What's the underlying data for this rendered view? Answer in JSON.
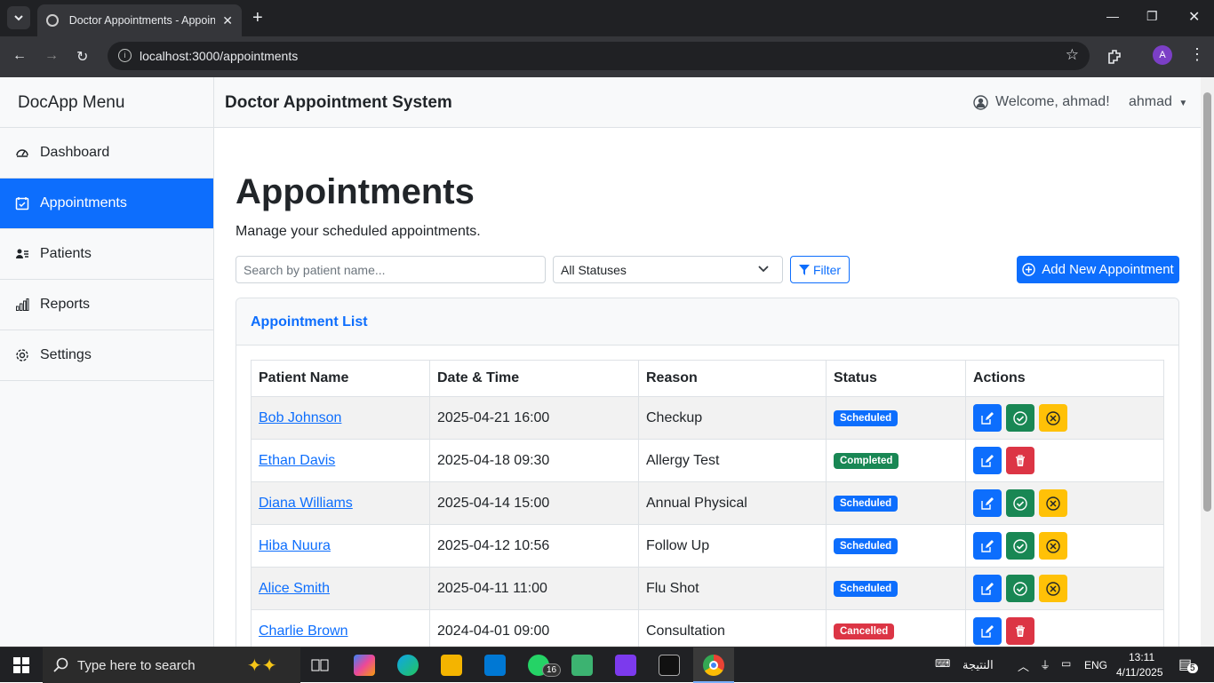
{
  "browser": {
    "tab_title": "Doctor Appointments - Appointments",
    "url": "localhost:3000/appointments",
    "profile_initial": "A"
  },
  "sidebar": {
    "brand": "DocApp Menu",
    "items": [
      {
        "label": "Dashboard",
        "icon": "dashboard-icon",
        "active": false
      },
      {
        "label": "Appointments",
        "icon": "calendar-check-icon",
        "active": true
      },
      {
        "label": "Patients",
        "icon": "patients-icon",
        "active": false
      },
      {
        "label": "Reports",
        "icon": "bar-chart-icon",
        "active": false
      },
      {
        "label": "Settings",
        "icon": "gear-icon",
        "active": false
      }
    ]
  },
  "header": {
    "title": "Doctor Appointment System",
    "welcome": "Welcome, ahmad!",
    "user": "ahmad"
  },
  "page": {
    "title": "Appointments",
    "subtitle": "Manage your scheduled appointments."
  },
  "filters": {
    "search_placeholder": "Search by patient name...",
    "status_selected": "All Statuses",
    "filter_label": "Filter",
    "add_label": "Add New Appointment"
  },
  "card": {
    "title": "Appointment List"
  },
  "table": {
    "headers": [
      "Patient Name",
      "Date & Time",
      "Reason",
      "Status",
      "Actions"
    ],
    "rows": [
      {
        "patient": "Bob Johnson",
        "datetime": "2025-04-21 16:00",
        "reason": "Checkup",
        "status": "Scheduled"
      },
      {
        "patient": "Ethan Davis",
        "datetime": "2025-04-18 09:30",
        "reason": "Allergy Test",
        "status": "Completed"
      },
      {
        "patient": "Diana Williams",
        "datetime": "2025-04-14 15:00",
        "reason": "Annual Physical",
        "status": "Scheduled"
      },
      {
        "patient": "Hiba Nuura",
        "datetime": "2025-04-12 10:56",
        "reason": "Follow Up",
        "status": "Scheduled"
      },
      {
        "patient": "Alice Smith",
        "datetime": "2025-04-11 11:00",
        "reason": "Flu Shot",
        "status": "Scheduled"
      },
      {
        "patient": "Charlie Brown",
        "datetime": "2024-04-01 09:00",
        "reason": "Consultation",
        "status": "Cancelled"
      }
    ]
  },
  "colors": {
    "primary": "#0d6efd",
    "success": "#198754",
    "warning": "#ffc107",
    "danger": "#dc3545"
  },
  "taskbar": {
    "search_placeholder": "Type here to search",
    "whatsapp_badge": "16",
    "lang_label": "النتيجة",
    "lang": "ENG",
    "time": "13:11",
    "date": "4/11/2025",
    "notifications": "5"
  }
}
